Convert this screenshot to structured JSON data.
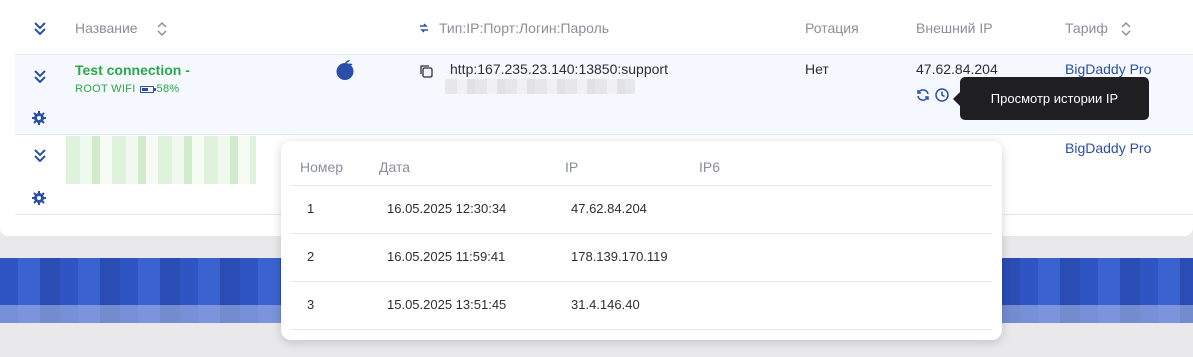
{
  "table": {
    "headers": {
      "name": "Название",
      "type": "Тип:IP:Порт:Логин:Пароль",
      "rotation": "Ротация",
      "external_ip": "Внешний IP",
      "tariff": "Тариф"
    },
    "rows": [
      {
        "name": "Test connection -",
        "connection": "ROOT WIFI",
        "battery": "58%",
        "proxy": "http:167.235.23.140:13850:support",
        "rotation": "Нет",
        "external_ip": "47.62.84.204",
        "tariff": "BigDaddy Pro"
      },
      {
        "tariff": "BigDaddy Pro"
      }
    ]
  },
  "tooltip": {
    "text": "Просмотр истории IP"
  },
  "ip_history": {
    "headers": {
      "num": "Номер",
      "date": "Дата",
      "ip": "IP",
      "ip6": "IP6"
    },
    "rows": [
      {
        "num": "1",
        "date": "16.05.2025 12:30:34",
        "ip": "47.62.84.204",
        "ip6": ""
      },
      {
        "num": "2",
        "date": "16.05.2025 11:59:41",
        "ip": "178.139.170.119",
        "ip6": ""
      },
      {
        "num": "3",
        "date": "15.05.2025 13:51:45",
        "ip": "31.4.146.40",
        "ip6": ""
      }
    ]
  },
  "colors": {
    "accent": "#2a4fa8",
    "success": "#2ca84a",
    "tooltip_bg": "#1f1f22"
  },
  "icons": [
    "collapse-all-icon",
    "sort-icon",
    "arrows-icon",
    "expand-icon",
    "apple-icon",
    "copy-icon",
    "refresh-icon",
    "history-icon",
    "gear-icon"
  ]
}
